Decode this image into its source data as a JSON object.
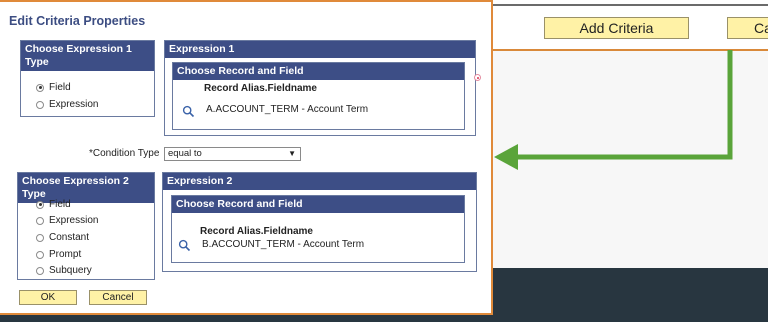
{
  "dialog": {
    "title": "Edit Criteria Properties",
    "expr1_type": {
      "header": "Choose Expression 1 Type",
      "options": [
        {
          "label": "Field",
          "selected": true
        },
        {
          "label": "Expression",
          "selected": false
        }
      ]
    },
    "expr1": {
      "header": "Expression 1",
      "choose_header": "Choose Record and Field",
      "record_label": "Record Alias.Fieldname",
      "value": "A.ACCOUNT_TERM - Account Term"
    },
    "condition": {
      "label": "*Condition Type",
      "value": "equal to"
    },
    "expr2_type": {
      "header": "Choose Expression 2 Type",
      "options": [
        {
          "label": "Field",
          "selected": true
        },
        {
          "label": "Expression",
          "selected": false
        },
        {
          "label": "Constant",
          "selected": false
        },
        {
          "label": "Prompt",
          "selected": false
        },
        {
          "label": "Subquery",
          "selected": false
        }
      ]
    },
    "expr2": {
      "header": "Expression 2",
      "choose_header": "Choose Record and Field",
      "record_label": "Record Alias.Fieldname",
      "value": "B.ACCOUNT_TERM - Account Term"
    },
    "ok_label": "OK",
    "cancel_label": "Cancel"
  },
  "background_window": {
    "add_criteria_label": "Add Criteria",
    "cancel_partial_label": "Ca"
  },
  "colors": {
    "dialog_border": "#e08a3a",
    "panel_header": "#3d4e86",
    "button_fill": "#fff2a6",
    "arrow": "#5aa43a"
  },
  "icons": {
    "lookup": "magnifier-icon",
    "select_arrow": "dropdown-arrow-icon",
    "callout": "green-arrow-icon"
  }
}
